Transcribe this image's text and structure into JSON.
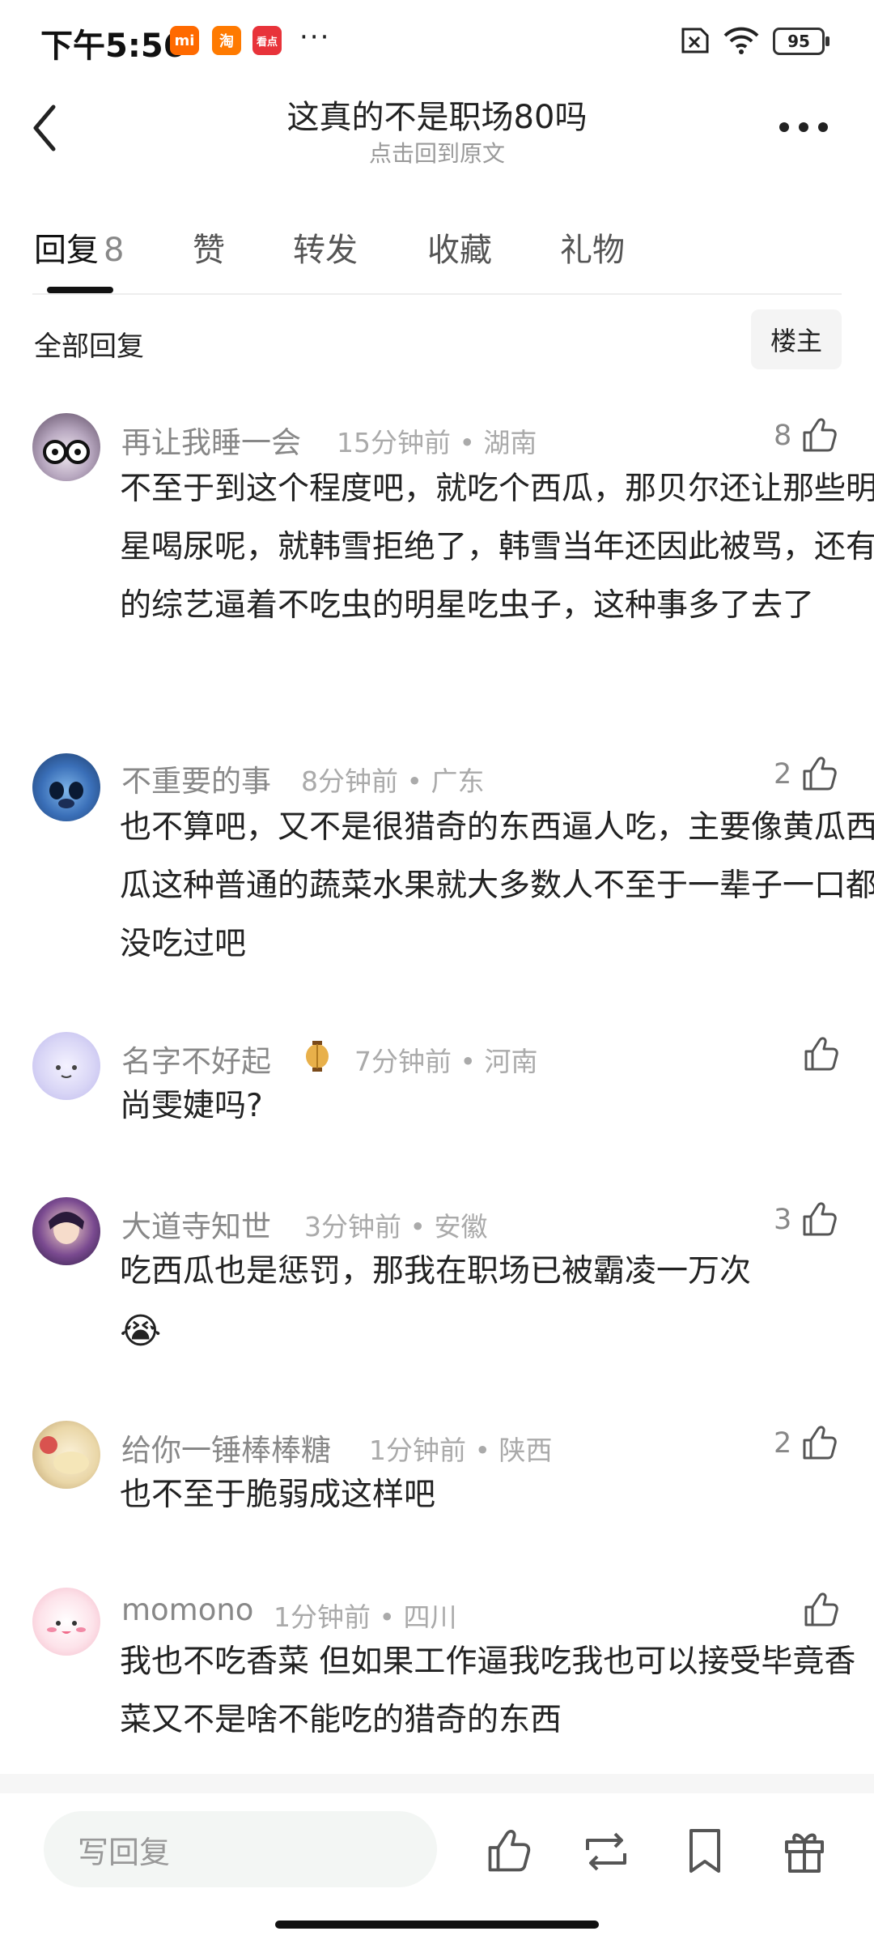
{
  "status_bar": {
    "time": "下午5:56",
    "apps": [
      {
        "label": "mi",
        "color": "#ff6a00"
      },
      {
        "label": "淘",
        "color": "#ff7a00"
      },
      {
        "label": "看点",
        "color": "#e8333a"
      }
    ],
    "more": "···",
    "battery": "95"
  },
  "header": {
    "title": "这真的不是职场80吗",
    "subtitle": "点击回到原文"
  },
  "tabs": [
    {
      "label": "回复",
      "count": "8"
    },
    {
      "label": "赞"
    },
    {
      "label": "转发"
    },
    {
      "label": "收藏"
    },
    {
      "label": "礼物"
    }
  ],
  "filter": {
    "all_label": "全部回复",
    "owner_label": "楼主"
  },
  "comments": [
    {
      "username": "再让我睡一会",
      "meta": "15分钟前 • 湖南",
      "likes": "8",
      "content": "不至于到这个程度吧，就吃个西瓜，那贝尔还让那些明星喝尿呢，就韩雪拒绝了，韩雪当年还因此被骂，还有的综艺逼着不吃虫的明星吃虫子，这种事多了去了"
    },
    {
      "username": "不重要的事",
      "meta": "8分钟前 • 广东",
      "likes": "2",
      "content": "也不算吧，又不是很猎奇的东西逼人吃，主要像黄瓜西瓜这种普通的蔬菜水果就大多数人不至于一辈子一口都没吃过吧"
    },
    {
      "username": "名字不好起",
      "meta": "7分钟前 • 河南",
      "likes": "",
      "content": "尚雯婕吗?"
    },
    {
      "username": "大道寺知世",
      "meta": "3分钟前 • 安徽",
      "likes": "3",
      "content": "吃西瓜也是惩罚，那我在职场已被霸凌一万次"
    },
    {
      "username": "给你一锤棒棒糖",
      "meta": "1分钟前 • 陕西",
      "likes": "2",
      "content": "也不至于脆弱成这样吧"
    },
    {
      "username": "momono",
      "meta": "1分钟前 • 四川",
      "likes": "",
      "content": "我也不吃香菜 但如果工作逼我吃我也可以接受毕竟香菜又不是啥不能吃的猎奇的东西"
    }
  ],
  "emoji": "😭",
  "bottom_bar": {
    "reply_placeholder": "写回复"
  }
}
